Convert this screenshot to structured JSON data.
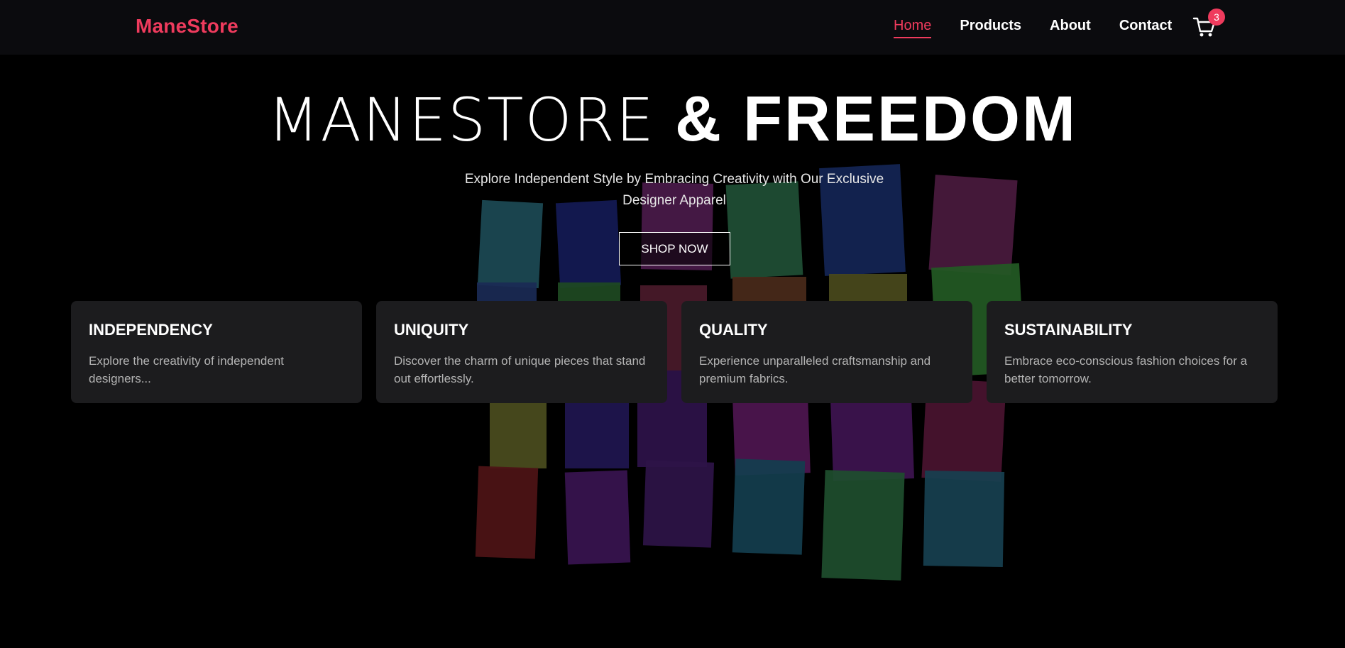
{
  "brand": "ManeStore",
  "nav": {
    "items": [
      {
        "label": "Home",
        "active": true
      },
      {
        "label": "Products",
        "active": false
      },
      {
        "label": "About",
        "active": false
      },
      {
        "label": "Contact",
        "active": false
      }
    ],
    "cart_count": "3"
  },
  "hero": {
    "title_light": "MANESTORE",
    "title_bold": "& FREEDOM",
    "subtitle": "Explore Independent Style by Embracing Creativity with Our Exclusive Designer Apparel",
    "cta": "SHOP NOW"
  },
  "features": [
    {
      "title": "INDEPENDENCY",
      "desc": "Explore the creativity of independent designers..."
    },
    {
      "title": "UNIQUITY",
      "desc": "Discover the charm of unique pieces that stand out effortlessly."
    },
    {
      "title": "QUALITY",
      "desc": "Experience unparalleled craftsmanship and premium fabrics."
    },
    {
      "title": "SUSTAINABILITY",
      "desc": "Embrace eco-conscious fashion choices for a better tomorrow."
    }
  ],
  "colors": {
    "accent": "#ef3b5d",
    "nav_bg": "#0b0b0e",
    "card_bg": "#1c1c1e",
    "page_bg": "#000000"
  },
  "icons": {
    "cart": "cart-icon"
  }
}
